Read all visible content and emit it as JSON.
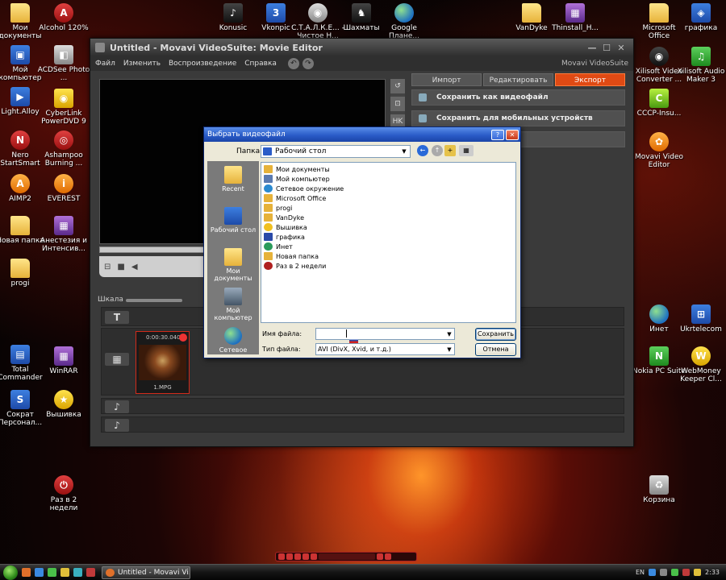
{
  "desktop_icons": {
    "left": [
      {
        "label": "Мои документы",
        "glyph": "folder-icon"
      },
      {
        "label": "Мой компьютер",
        "glyph": "computer-icon"
      },
      {
        "label": "Light.Alloy",
        "glyph": "media-player-icon"
      },
      {
        "label": "Nero StartSmart",
        "glyph": "nero-icon"
      },
      {
        "label": "AIMP2",
        "glyph": "aimp-icon"
      },
      {
        "label": "Новая папка",
        "glyph": "folder-icon"
      },
      {
        "label": "progi",
        "glyph": "folder-icon"
      },
      {
        "label": "Total Commander",
        "glyph": "floppy-icon"
      },
      {
        "label": "Сократ Персонал...",
        "glyph": "translator-icon"
      }
    ],
    "left2": [
      {
        "label": "Alcohol 120%",
        "glyph": "alcohol-icon"
      },
      {
        "label": "ACDSee Photo ...",
        "glyph": "acdsee-icon"
      },
      {
        "label": "CyberLink PowerDVD 9",
        "glyph": "dvd-icon"
      },
      {
        "label": "Ashampoo Burning ...",
        "glyph": "ashampoo-icon"
      },
      {
        "label": "EVEREST",
        "glyph": "everest-icon"
      },
      {
        "label": "Анестезия и Интенсив...",
        "glyph": "archive-icon"
      },
      {
        "label": "WinRAR",
        "glyph": "winrar-icon"
      },
      {
        "label": "Вышивка",
        "glyph": "star-icon"
      },
      {
        "label": "Раз в 2 недели",
        "glyph": "power-icon"
      }
    ],
    "top": [
      {
        "label": "Konusic",
        "glyph": "konusic-icon"
      },
      {
        "label": "Vkonpic",
        "glyph": "vkonpic-icon"
      },
      {
        "label": "С.Т.А.Л.К.Е... - Чистое Н...",
        "glyph": "game-icon"
      },
      {
        "label": "Шахматы",
        "glyph": "chess-icon"
      },
      {
        "label": "Google Плане...",
        "glyph": "google-earth-icon"
      },
      {
        "label": "VanDyke",
        "glyph": "folder-icon"
      },
      {
        "label": "Thinstall_H...",
        "glyph": "archive-icon"
      }
    ],
    "right": [
      {
        "label": "Microsoft Office",
        "glyph": "folder-icon"
      },
      {
        "label": "Xilisoft Video Converter ...",
        "glyph": "film-icon"
      },
      {
        "label": "CCCP-Insu...",
        "glyph": "cccp-icon"
      },
      {
        "label": "Movavi Video Editor",
        "glyph": "movavi-icon"
      },
      {
        "label": "Инет",
        "glyph": "globe-icon"
      },
      {
        "label": "Nokia PC Suite",
        "glyph": "nokia-icon"
      },
      {
        "label": "Корзина",
        "glyph": "recycle-bin-icon"
      }
    ],
    "right2": [
      {
        "label": "графика",
        "glyph": "graphics-icon"
      },
      {
        "label": "Xilisoft Audio Maker 3",
        "glyph": "audio-icon"
      },
      {
        "label": "Ukrtelecom",
        "glyph": "network-icon"
      },
      {
        "label": "WebMoney Keeper Cl...",
        "glyph": "webmoney-icon"
      }
    ]
  },
  "movavi": {
    "title": "Untitled - Movavi VideoSuite: Movie Editor",
    "menu": [
      "Файл",
      "Изменить",
      "Воспроизведение",
      "Справка"
    ],
    "brand": "Movavi VideoSuite",
    "tabs": [
      "Импорт",
      "Редактировать",
      "Экспорт"
    ],
    "active_tab": "Экспорт",
    "actions": [
      "Сохранить как видеофайл",
      "Сохранить для мобильных устройств"
    ],
    "side_tools": [
      "↺",
      "⊡",
      "HK"
    ],
    "scale_label": "Шкала",
    "clip": {
      "timecode": "0:00:30.040",
      "name": "1.MPG"
    },
    "colors": {
      "accent": "#e04a14",
      "window_bg": "#3a3a3a"
    }
  },
  "dialog": {
    "title": "Выбрать видеофайл",
    "look_in_label": "Папка:",
    "look_in_value": "Рабочий стол",
    "places": [
      "Recent",
      "Рабочий стол",
      "Мои документы",
      "Мой компьютер",
      "Сетевое"
    ],
    "files": [
      {
        "name": "Мои документы",
        "icon": "folder-icon"
      },
      {
        "name": "Мой компьютер",
        "icon": "computer-icon"
      },
      {
        "name": "Сетевое окружение",
        "icon": "network-icon"
      },
      {
        "name": "Microsoft Office",
        "icon": "office-icon"
      },
      {
        "name": "progi",
        "icon": "folder-icon"
      },
      {
        "name": "VanDyke",
        "icon": "folder-icon"
      },
      {
        "name": "Вышивка",
        "icon": "star-icon"
      },
      {
        "name": "графика",
        "icon": "graphics-icon"
      },
      {
        "name": "Инет",
        "icon": "globe-icon"
      },
      {
        "name": "Новая папка",
        "icon": "folder-icon"
      },
      {
        "name": "Раз в 2 недели",
        "icon": "power-icon"
      }
    ],
    "filename_label": "Имя файла:",
    "filename_value": "",
    "filetype_label": "Тип файла:",
    "filetype_value": "AVI (DivX, Xvid, и т.д.)",
    "save_button": "Сохранить",
    "cancel_button": "Отмена"
  },
  "taskbar": {
    "task": "Untitled - Movavi Vi...",
    "language": "EN",
    "clock": "2:33"
  }
}
